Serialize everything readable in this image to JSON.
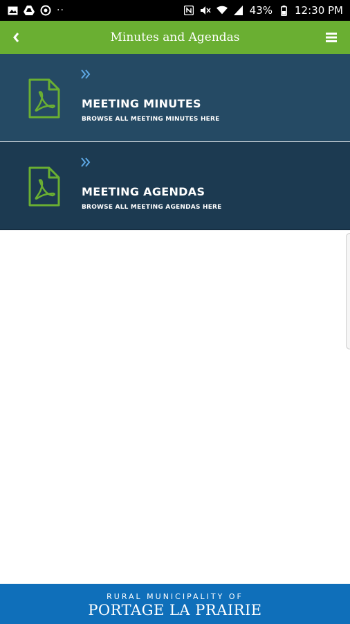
{
  "status_bar": {
    "icons_left": [
      "image-icon",
      "drive-icon",
      "at-sign-icon",
      "more-dots-icon"
    ],
    "dots": "··",
    "icons_right": [
      "nfc-icon",
      "mute-icon",
      "wifi-icon",
      "signal-icon"
    ],
    "battery": "43%",
    "time": "12:30 PM"
  },
  "header": {
    "title": "Minutes and Agendas",
    "background": "#6aaf32"
  },
  "items": [
    {
      "title": "MEETING MINUTES",
      "subtitle": "BROWSE ALL MEETING MINUTES HERE",
      "icon": "pdf-document-icon",
      "background": "#254a64"
    },
    {
      "title": "MEETING AGENDAS",
      "subtitle": "BROWSE ALL MEETING AGENDAS HERE",
      "icon": "pdf-document-icon",
      "background": "#1c3a51"
    }
  ],
  "footer": {
    "line1": "RURAL MUNICIPALITY OF",
    "line2": "PORTAGE LA PRAIRIE",
    "background": "#0f6fba"
  },
  "colors": {
    "accent_green": "#6aaf32",
    "chevron_blue": "#5ea9e6"
  }
}
